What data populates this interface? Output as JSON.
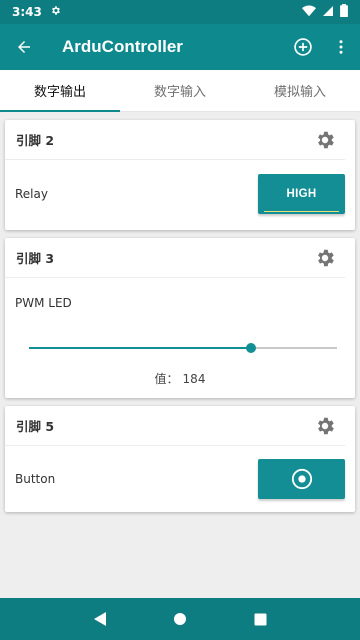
{
  "status_bar": {
    "time": "3:43"
  },
  "app_bar": {
    "title": "ArduController"
  },
  "tabs": [
    {
      "label": "数字输出",
      "active": true
    },
    {
      "label": "数字输入",
      "active": false
    },
    {
      "label": "模拟输入",
      "active": false
    }
  ],
  "cards": {
    "pin2": {
      "title": "引脚 2",
      "label": "Relay",
      "button_label": "HIGH"
    },
    "pin3": {
      "title": "引脚 3",
      "label": "PWM LED",
      "value_prefix": "值：",
      "value": "184",
      "slider_fraction": 0.72
    },
    "pin5": {
      "title": "引脚 5",
      "label": "Button"
    }
  },
  "colors": {
    "primary": "#0e8a8f",
    "primary_dark": "#0e7d82",
    "button": "#138e94",
    "background": "#eeeeee"
  },
  "icons": {
    "back": "arrow-back-icon",
    "add": "add-circle-icon",
    "more": "more-vert-icon",
    "settings": "gear-icon",
    "radio": "radio-button-icon"
  }
}
